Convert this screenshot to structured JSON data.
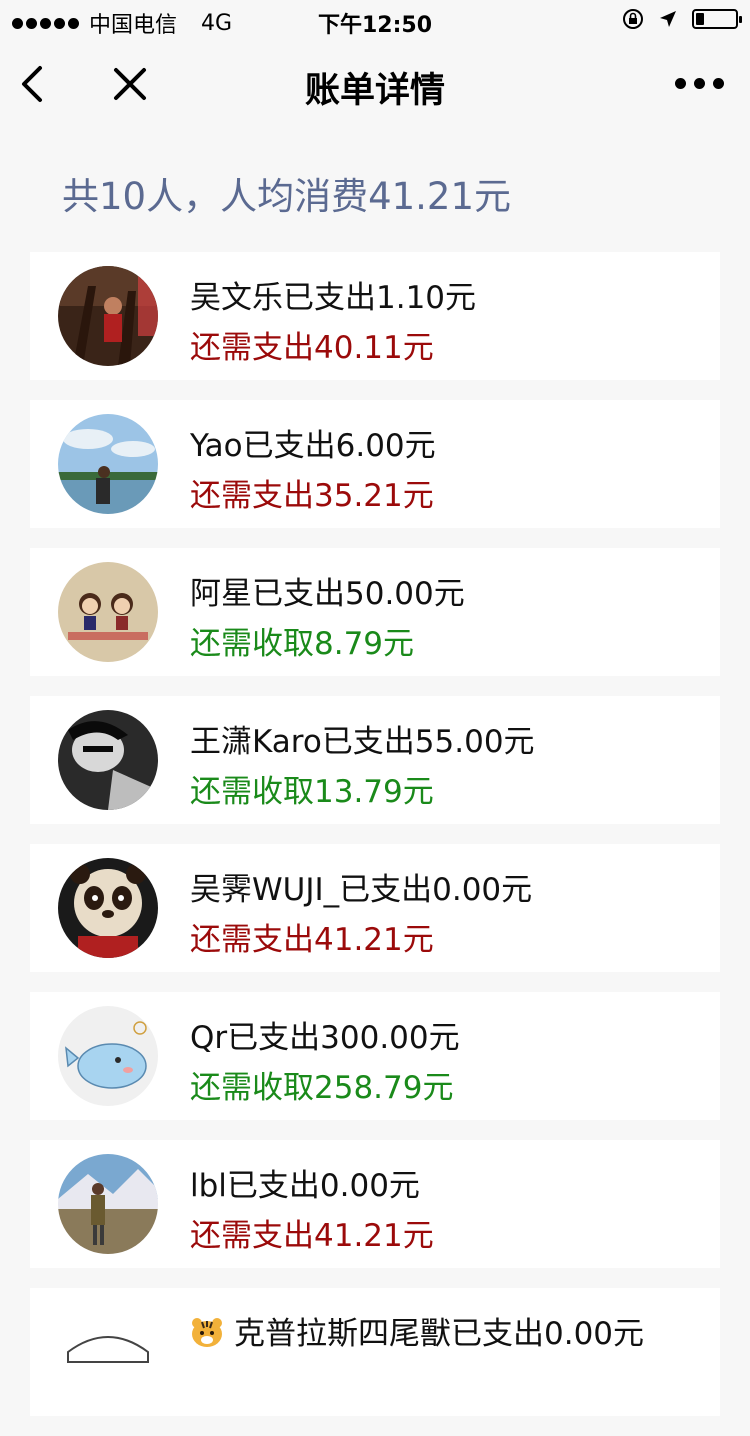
{
  "status_bar": {
    "carrier": "中国电信",
    "network": "4G",
    "time": "下午12:50",
    "battery_level": 0.2
  },
  "nav": {
    "title": "账单详情",
    "back_icon": "chevron-left-icon",
    "close_icon": "close-icon",
    "more_icon": "more-icon"
  },
  "summary": "共10人，人均消费41.21元",
  "colors": {
    "summary": "#5b6a91",
    "need_pay": "#9b0a0a",
    "need_receive": "#1a8a1a"
  },
  "members": [
    {
      "paid_text": "吴文乐已支出1.10元",
      "balance_text": "还需支出40.11元",
      "balance_type": "pay"
    },
    {
      "paid_text": "Yao已支出6.00元",
      "balance_text": "还需支出35.21元",
      "balance_type": "pay"
    },
    {
      "paid_text": "阿星已支出50.00元",
      "balance_text": "还需收取8.79元",
      "balance_type": "receive"
    },
    {
      "paid_text": "王潇Karo已支出55.00元",
      "balance_text": "还需收取13.79元",
      "balance_type": "receive"
    },
    {
      "paid_text": "吴霁WUJI_已支出0.00元",
      "balance_text": "还需支出41.21元",
      "balance_type": "pay"
    },
    {
      "paid_text": "Qr已支出300.00元",
      "balance_text": "还需收取258.79元",
      "balance_type": "receive"
    },
    {
      "paid_text": "lbl已支出0.00元",
      "balance_text": "还需支出41.21元",
      "balance_type": "pay"
    },
    {
      "paid_text": "克普拉斯四尾獸已支出0.00元",
      "balance_text": "",
      "balance_type": "pay"
    }
  ]
}
